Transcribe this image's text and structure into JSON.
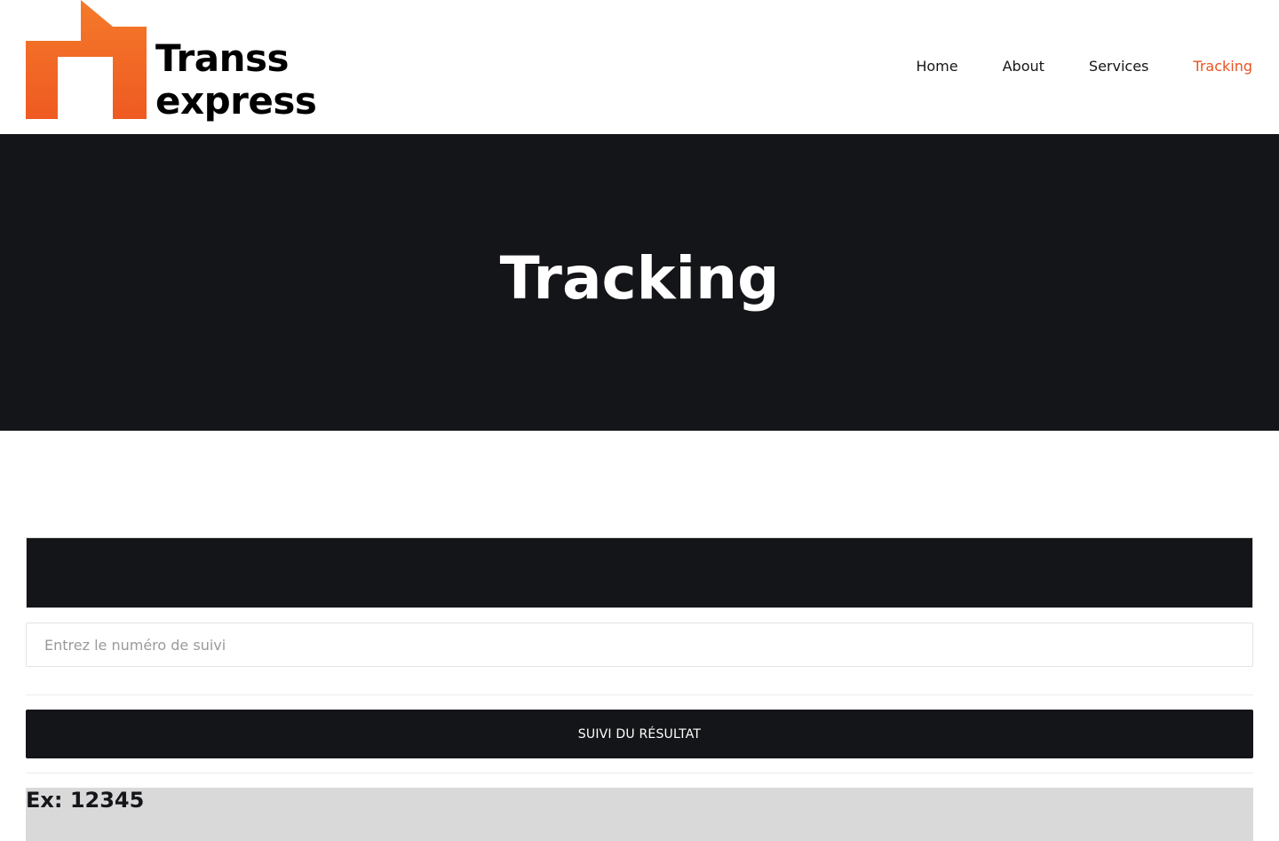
{
  "header": {
    "brand": {
      "line1": "Transs",
      "line2": "express",
      "accent_color": "#f15a24",
      "logo_icon": "house-logo-icon"
    },
    "nav": [
      {
        "label": "Home",
        "active": false
      },
      {
        "label": "About",
        "active": false
      },
      {
        "label": "Services",
        "active": false
      },
      {
        "label": "Tracking",
        "active": true
      }
    ],
    "active_color": "#e8541f"
  },
  "hero": {
    "title": "Tracking",
    "background": "#141518"
  },
  "tracking_form": {
    "input_placeholder": "Entrez le numéro de suivi",
    "input_value": "",
    "submit_label": "SUIVI DU RÉSULTAT",
    "example_text": "Ex: 12345"
  }
}
